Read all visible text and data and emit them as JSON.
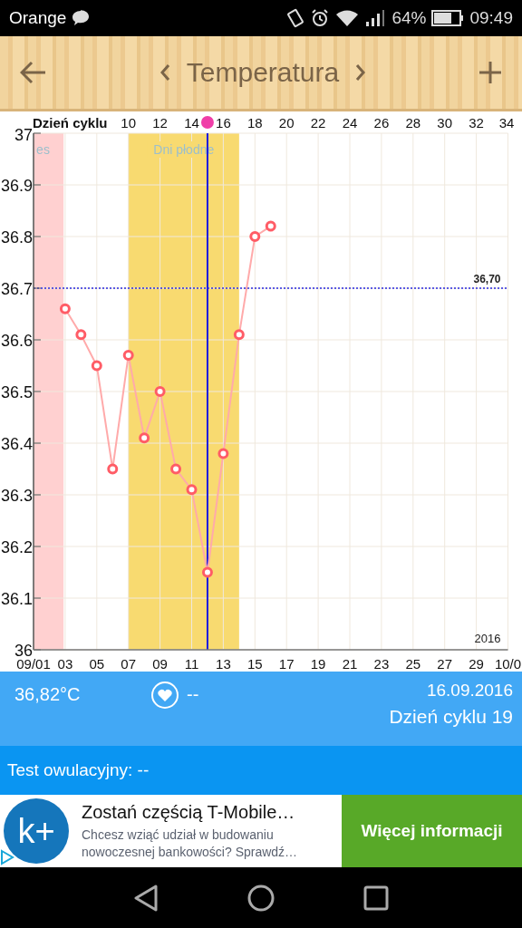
{
  "status_bar": {
    "carrier": "Orange",
    "battery": "64%",
    "time": "09:49"
  },
  "toolbar": {
    "title": "Temperatura"
  },
  "chart": {
    "top_axis": {
      "title": "Dzień cyklu",
      "ticks": [
        "10",
        "12",
        "14",
        "16",
        "18",
        "20",
        "22",
        "24",
        "26",
        "28",
        "30",
        "32",
        "34"
      ]
    },
    "year_label": "2016",
    "chart_data": {
      "type": "line",
      "x": [
        3,
        4,
        5,
        6,
        7,
        8,
        9,
        10,
        11,
        12,
        13,
        14,
        15,
        16
      ],
      "values": [
        36.66,
        36.61,
        36.55,
        36.35,
        36.57,
        36.41,
        36.5,
        36.35,
        36.31,
        36.15,
        36.38,
        36.61,
        36.8,
        36.82
      ],
      "grid": true,
      "marker": true,
      "bands": [
        {
          "axis": "x",
          "from": 1,
          "to": 2.9,
          "label": "es",
          "color": "#ffd0d0"
        },
        {
          "axis": "x",
          "from": 7,
          "to": 14,
          "label": "Dni płodne",
          "color": "#f8da70"
        }
      ],
      "ref_lines": [
        {
          "axis": "x",
          "value": 12,
          "color": "#1a1ae0"
        },
        {
          "axis": "y",
          "value": 36.7,
          "label": "36,70",
          "color": "#2a2ae0"
        }
      ],
      "xlim": [
        1,
        31
      ],
      "ylim": [
        36,
        37
      ],
      "xticks": [
        {
          "value": 1,
          "label": "09/01"
        },
        {
          "value": 3,
          "label": "03"
        },
        {
          "value": 5,
          "label": "05"
        },
        {
          "value": 7,
          "label": "07"
        },
        {
          "value": 9,
          "label": "09"
        },
        {
          "value": 11,
          "label": "11"
        },
        {
          "value": 13,
          "label": "13"
        },
        {
          "value": 15,
          "label": "15"
        },
        {
          "value": 17,
          "label": "17"
        },
        {
          "value": 19,
          "label": "19"
        },
        {
          "value": 21,
          "label": "21"
        },
        {
          "value": 23,
          "label": "23"
        },
        {
          "value": 25,
          "label": "25"
        },
        {
          "value": 27,
          "label": "27"
        },
        {
          "value": 29,
          "label": "29"
        },
        {
          "value": 31,
          "label": "10/0"
        }
      ],
      "yticks": [
        {
          "value": 36,
          "label": "36"
        },
        {
          "value": 36.1,
          "label": "36.1"
        },
        {
          "value": 36.2,
          "label": "36.2"
        },
        {
          "value": 36.3,
          "label": "36.3"
        },
        {
          "value": 36.4,
          "label": "36.4"
        },
        {
          "value": 36.5,
          "label": "36.5"
        },
        {
          "value": 36.6,
          "label": "36.6"
        },
        {
          "value": 36.7,
          "label": "36.7"
        },
        {
          "value": 36.8,
          "label": "36.8"
        },
        {
          "value": 36.9,
          "label": "36.9"
        },
        {
          "value": 37,
          "label": "37"
        }
      ]
    }
  },
  "info": {
    "temperature": "36,82°C",
    "note": "--",
    "date": "16.09.2016",
    "cycle_day": "Dzień cyklu 19"
  },
  "ovulation_test": "Test owulacyjny: --",
  "ad": {
    "logo": "k+",
    "title": "Zostań częścią T-Mobile…",
    "text": "Chcesz wziąć udział w budowaniu nowoczesnej bankowości? Sprawdź…",
    "button": "Więcej informacji"
  }
}
